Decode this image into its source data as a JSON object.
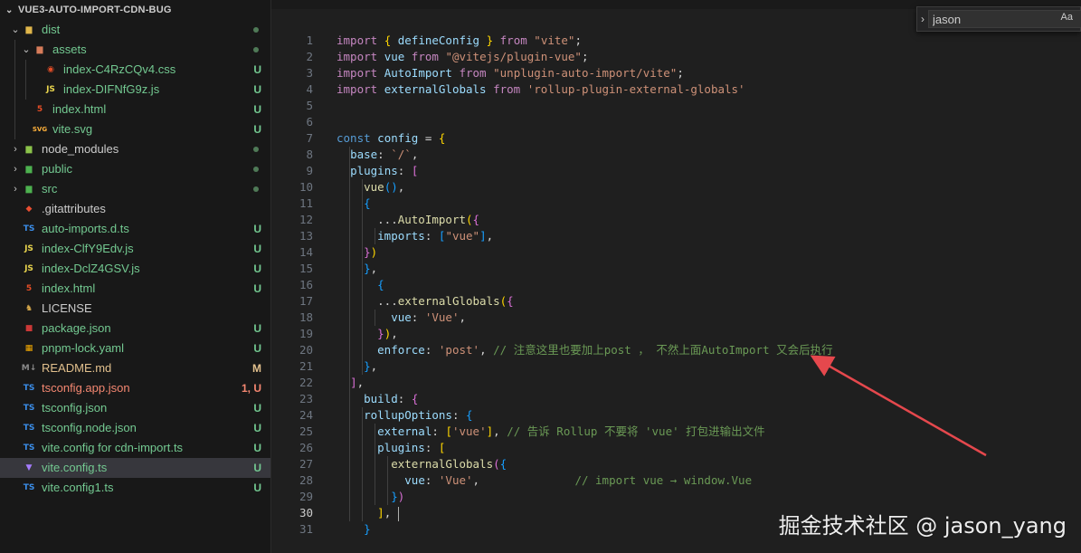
{
  "explorer": {
    "project_name": "VUE3-AUTO-IMPORT-CDN-BUG",
    "items": [
      {
        "name": "dist",
        "type": "folder",
        "expanded": true,
        "depth": 1,
        "icon": "dist-folder-icon",
        "status": "dot",
        "color": "#73c991"
      },
      {
        "name": "assets",
        "type": "folder",
        "expanded": true,
        "depth": 2,
        "icon": "assets-folder-icon",
        "status": "dot",
        "color": "#73c991"
      },
      {
        "name": "index-C4RzCQv4.css",
        "type": "file",
        "depth": 3,
        "icon": "css-file-icon",
        "status": "U",
        "color": "#73c991"
      },
      {
        "name": "index-DIFNfG9z.js",
        "type": "file",
        "depth": 3,
        "icon": "js-file-icon",
        "status": "U",
        "color": "#73c991"
      },
      {
        "name": "index.html",
        "type": "file",
        "depth": 2,
        "icon": "html-file-icon",
        "status": "U",
        "color": "#73c991"
      },
      {
        "name": "vite.svg",
        "type": "file",
        "depth": 2,
        "icon": "svg-file-icon",
        "status": "U",
        "color": "#73c991"
      },
      {
        "name": "node_modules",
        "type": "folder",
        "expanded": false,
        "depth": 1,
        "icon": "node-folder-icon",
        "status": "dot",
        "color": "#cccccc"
      },
      {
        "name": "public",
        "type": "folder",
        "expanded": false,
        "depth": 1,
        "icon": "public-folder-icon",
        "status": "dot",
        "color": "#73c991"
      },
      {
        "name": "src",
        "type": "folder",
        "expanded": false,
        "depth": 1,
        "icon": "src-folder-icon",
        "status": "dot",
        "color": "#73c991"
      },
      {
        "name": ".gitattributes",
        "type": "file",
        "depth": 1,
        "icon": "git-file-icon",
        "status": "",
        "color": "#cccccc"
      },
      {
        "name": "auto-imports.d.ts",
        "type": "file",
        "depth": 1,
        "icon": "ts-file-icon",
        "status": "U",
        "color": "#73c991"
      },
      {
        "name": "index-ClfY9Edv.js",
        "type": "file",
        "depth": 1,
        "icon": "js-file-icon",
        "status": "U",
        "color": "#73c991"
      },
      {
        "name": "index-DclZ4GSV.js",
        "type": "file",
        "depth": 1,
        "icon": "js-file-icon",
        "status": "U",
        "color": "#73c991"
      },
      {
        "name": "index.html",
        "type": "file",
        "depth": 1,
        "icon": "html-file-icon",
        "status": "U",
        "color": "#73c991"
      },
      {
        "name": "LICENSE",
        "type": "file",
        "depth": 1,
        "icon": "license-file-icon",
        "status": "",
        "color": "#cccccc"
      },
      {
        "name": "package.json",
        "type": "file",
        "depth": 1,
        "icon": "npm-file-icon",
        "status": "U",
        "color": "#73c991"
      },
      {
        "name": "pnpm-lock.yaml",
        "type": "file",
        "depth": 1,
        "icon": "pnpm-file-icon",
        "status": "U",
        "color": "#73c991"
      },
      {
        "name": "README.md",
        "type": "file",
        "depth": 1,
        "icon": "markdown-file-icon",
        "status": "M",
        "color": "#e2c08d"
      },
      {
        "name": "tsconfig.app.json",
        "type": "file",
        "depth": 1,
        "icon": "tsconfig-file-icon",
        "status": "1, U",
        "color": "#f48771"
      },
      {
        "name": "tsconfig.json",
        "type": "file",
        "depth": 1,
        "icon": "tsconfig-file-icon",
        "status": "U",
        "color": "#73c991"
      },
      {
        "name": "tsconfig.node.json",
        "type": "file",
        "depth": 1,
        "icon": "tsconfig-file-icon",
        "status": "U",
        "color": "#73c991"
      },
      {
        "name": "vite.config for cdn-import.ts",
        "type": "file",
        "depth": 1,
        "icon": "ts-file-icon",
        "status": "U",
        "color": "#73c991"
      },
      {
        "name": "vite.config.ts",
        "type": "file",
        "depth": 1,
        "icon": "vite-file-icon",
        "status": "U",
        "color": "#73c991",
        "selected": true
      },
      {
        "name": "vite.config1.ts",
        "type": "file",
        "depth": 1,
        "icon": "ts-file-icon",
        "status": "U",
        "color": "#73c991"
      }
    ]
  },
  "find_widget": {
    "value": "jason",
    "match_case_label": "Aa"
  },
  "editor": {
    "active_line": 30,
    "lines": [
      {
        "n": 1,
        "tokens": [
          [
            "kw",
            "import"
          ],
          [
            "pn",
            " "
          ],
          [
            "br1",
            "{"
          ],
          [
            "pn",
            " "
          ],
          [
            "id",
            "defineConfig"
          ],
          [
            "pn",
            " "
          ],
          [
            "br1",
            "}"
          ],
          [
            "pn",
            " "
          ],
          [
            "kw",
            "from"
          ],
          [
            "pn",
            " "
          ],
          [
            "str",
            "\"vite\""
          ],
          [
            "pn",
            ";"
          ]
        ]
      },
      {
        "n": 2,
        "tokens": [
          [
            "kw",
            "import"
          ],
          [
            "pn",
            " "
          ],
          [
            "id",
            "vue"
          ],
          [
            "pn",
            " "
          ],
          [
            "kw",
            "from"
          ],
          [
            "pn",
            " "
          ],
          [
            "str",
            "\"@vitejs/plugin-vue\""
          ],
          [
            "pn",
            ";"
          ]
        ]
      },
      {
        "n": 3,
        "tokens": [
          [
            "kw",
            "import"
          ],
          [
            "pn",
            " "
          ],
          [
            "id",
            "AutoImport"
          ],
          [
            "pn",
            " "
          ],
          [
            "kw",
            "from"
          ],
          [
            "pn",
            " "
          ],
          [
            "str",
            "\"unplugin-auto-import/vite\""
          ],
          [
            "pn",
            ";"
          ]
        ]
      },
      {
        "n": 4,
        "tokens": [
          [
            "kw",
            "import"
          ],
          [
            "pn",
            " "
          ],
          [
            "id",
            "externalGlobals"
          ],
          [
            "pn",
            " "
          ],
          [
            "kw",
            "from"
          ],
          [
            "pn",
            " "
          ],
          [
            "str",
            "'rollup-plugin-external-globals'"
          ]
        ]
      },
      {
        "n": 5,
        "tokens": []
      },
      {
        "n": 6,
        "tokens": []
      },
      {
        "n": 7,
        "tokens": [
          [
            "kb",
            "const"
          ],
          [
            "pn",
            " "
          ],
          [
            "id",
            "config"
          ],
          [
            "pn",
            " = "
          ],
          [
            "br1",
            "{"
          ]
        ]
      },
      {
        "n": 8,
        "tokens": [
          [
            "pn",
            "  "
          ],
          [
            "id",
            "base"
          ],
          [
            "pn",
            ": "
          ],
          [
            "str",
            "`/`"
          ],
          [
            "pn",
            ","
          ]
        ]
      },
      {
        "n": 9,
        "tokens": [
          [
            "pn",
            "  "
          ],
          [
            "id",
            "plugins"
          ],
          [
            "pn",
            ": "
          ],
          [
            "br2",
            "["
          ]
        ]
      },
      {
        "n": 10,
        "tokens": [
          [
            "pn",
            "    "
          ],
          [
            "fn",
            "vue"
          ],
          [
            "br3",
            "()"
          ],
          [
            "pn",
            ","
          ]
        ]
      },
      {
        "n": 11,
        "tokens": [
          [
            "pn",
            "    "
          ],
          [
            "br3",
            "{"
          ]
        ]
      },
      {
        "n": 12,
        "tokens": [
          [
            "pn",
            "      ..."
          ],
          [
            "fn",
            "AutoImport"
          ],
          [
            "br1",
            "("
          ],
          [
            "br2",
            "{"
          ]
        ]
      },
      {
        "n": 13,
        "tokens": [
          [
            "pn",
            "      "
          ],
          [
            "id",
            "imports"
          ],
          [
            "pn",
            ": "
          ],
          [
            "br3",
            "["
          ],
          [
            "str",
            "\"vue\""
          ],
          [
            "br3",
            "]"
          ],
          [
            "pn",
            ","
          ]
        ]
      },
      {
        "n": 14,
        "tokens": [
          [
            "pn",
            "    "
          ],
          [
            "br2",
            "}"
          ],
          [
            "br1",
            ")"
          ]
        ]
      },
      {
        "n": 15,
        "tokens": [
          [
            "pn",
            "    "
          ],
          [
            "br3",
            "}"
          ],
          [
            "pn",
            ","
          ]
        ]
      },
      {
        "n": 16,
        "tokens": [
          [
            "pn",
            "      "
          ],
          [
            "br3",
            "{"
          ]
        ]
      },
      {
        "n": 17,
        "tokens": [
          [
            "pn",
            "      ..."
          ],
          [
            "fn",
            "externalGlobals"
          ],
          [
            "br1",
            "("
          ],
          [
            "br2",
            "{"
          ]
        ]
      },
      {
        "n": 18,
        "tokens": [
          [
            "pn",
            "        "
          ],
          [
            "id",
            "vue"
          ],
          [
            "pn",
            ": "
          ],
          [
            "str",
            "'Vue'"
          ],
          [
            "pn",
            ","
          ]
        ]
      },
      {
        "n": 19,
        "tokens": [
          [
            "pn",
            "      "
          ],
          [
            "br2",
            "}"
          ],
          [
            "br1",
            ")"
          ],
          [
            "pn",
            ","
          ]
        ]
      },
      {
        "n": 20,
        "tokens": [
          [
            "pn",
            "      "
          ],
          [
            "id",
            "enforce"
          ],
          [
            "pn",
            ": "
          ],
          [
            "str",
            "'post'"
          ],
          [
            "pn",
            ", "
          ],
          [
            "cm",
            "// 注意这里也要加上post ， 不然上面AutoImport 又会后执行"
          ]
        ]
      },
      {
        "n": 21,
        "tokens": [
          [
            "pn",
            "    "
          ],
          [
            "br3",
            "}"
          ],
          [
            "pn",
            ","
          ]
        ]
      },
      {
        "n": 22,
        "tokens": [
          [
            "pn",
            "  "
          ],
          [
            "br2",
            "]"
          ],
          [
            "pn",
            ","
          ]
        ]
      },
      {
        "n": 23,
        "tokens": [
          [
            "pn",
            "    "
          ],
          [
            "id",
            "build"
          ],
          [
            "pn",
            ": "
          ],
          [
            "br2",
            "{"
          ]
        ]
      },
      {
        "n": 24,
        "tokens": [
          [
            "pn",
            "    "
          ],
          [
            "id",
            "rollupOptions"
          ],
          [
            "pn",
            ": "
          ],
          [
            "br3",
            "{"
          ]
        ]
      },
      {
        "n": 25,
        "tokens": [
          [
            "pn",
            "      "
          ],
          [
            "id",
            "external"
          ],
          [
            "pn",
            ": "
          ],
          [
            "br1",
            "["
          ],
          [
            "str",
            "'vue'"
          ],
          [
            "br1",
            "]"
          ],
          [
            "pn",
            ", "
          ],
          [
            "cm",
            "// 告诉 Rollup 不要将 'vue' 打包进输出文件"
          ]
        ]
      },
      {
        "n": 26,
        "tokens": [
          [
            "pn",
            "      "
          ],
          [
            "id",
            "plugins"
          ],
          [
            "pn",
            ": "
          ],
          [
            "br1",
            "["
          ]
        ]
      },
      {
        "n": 27,
        "tokens": [
          [
            "pn",
            "        "
          ],
          [
            "fn",
            "externalGlobals"
          ],
          [
            "br2",
            "("
          ],
          [
            "br3",
            "{"
          ]
        ]
      },
      {
        "n": 28,
        "tokens": [
          [
            "pn",
            "          "
          ],
          [
            "id",
            "vue"
          ],
          [
            "pn",
            ": "
          ],
          [
            "str",
            "'Vue'"
          ],
          [
            "pn",
            ",              "
          ],
          [
            "cm",
            "// import vue → window.Vue"
          ]
        ]
      },
      {
        "n": 29,
        "tokens": [
          [
            "pn",
            "        "
          ],
          [
            "br3",
            "}"
          ],
          [
            "br2",
            ")"
          ]
        ]
      },
      {
        "n": 30,
        "tokens": [
          [
            "pn",
            "      "
          ],
          [
            "br1",
            "]"
          ],
          [
            "pn",
            ", "
          ],
          [
            "caret",
            ""
          ]
        ]
      },
      {
        "n": 31,
        "tokens": [
          [
            "pn",
            "    "
          ],
          [
            "br3",
            "}"
          ]
        ]
      }
    ]
  },
  "watermark": "掘金技术社区 @ jason_yang",
  "colors": {
    "arrow": "#e5484d",
    "untracked": "#73c991",
    "modified": "#e2c08d",
    "error": "#f48771"
  }
}
